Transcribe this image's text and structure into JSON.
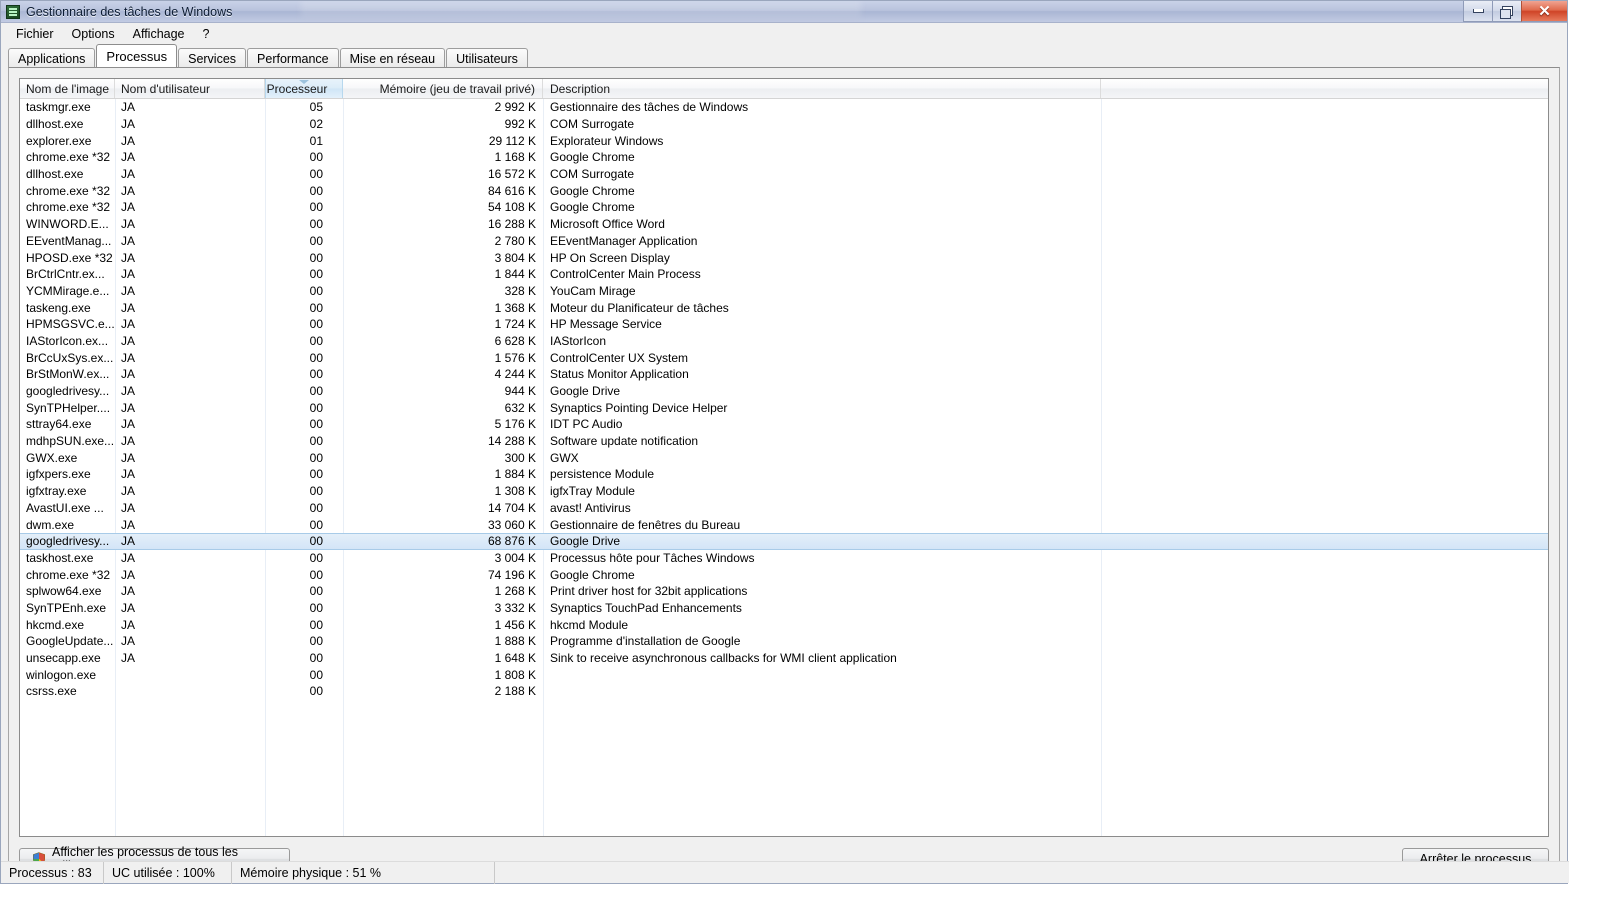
{
  "window": {
    "title": "Gestionnaire des tâches de Windows",
    "icon": "taskmanager-icon",
    "minimize_label": "",
    "maximize_label": "",
    "close_label": "✕"
  },
  "menu": {
    "items": [
      "Fichier",
      "Options",
      "Affichage",
      "?"
    ]
  },
  "tabs": {
    "items": [
      {
        "label": "Applications",
        "active": false
      },
      {
        "label": "Processus",
        "active": true
      },
      {
        "label": "Services",
        "active": false
      },
      {
        "label": "Performance",
        "active": false
      },
      {
        "label": "Mise en réseau",
        "active": false
      },
      {
        "label": "Utilisateurs",
        "active": false
      }
    ]
  },
  "table": {
    "columns": [
      {
        "key": "name",
        "label": "Nom de l'image",
        "align": "left",
        "sorted": false
      },
      {
        "key": "user",
        "label": "Nom d'utilisateur",
        "align": "left",
        "sorted": false
      },
      {
        "key": "cpu",
        "label": "Processeur",
        "align": "center",
        "sorted": true,
        "sort_dir": "desc"
      },
      {
        "key": "mem",
        "label": "Mémoire (jeu de travail privé)",
        "align": "right",
        "sorted": false
      },
      {
        "key": "desc",
        "label": "Description",
        "align": "left",
        "sorted": false
      }
    ],
    "selected_index": 26,
    "rows": [
      {
        "name": "taskmgr.exe",
        "user": "JA",
        "cpu": "05",
        "mem": "2 992 K",
        "desc": "Gestionnaire des tâches de Windows"
      },
      {
        "name": "dllhost.exe",
        "user": "JA",
        "cpu": "02",
        "mem": "992 K",
        "desc": "COM Surrogate"
      },
      {
        "name": "explorer.exe",
        "user": "JA",
        "cpu": "01",
        "mem": "29 112 K",
        "desc": "Explorateur Windows"
      },
      {
        "name": "chrome.exe *32",
        "user": "JA",
        "cpu": "00",
        "mem": "1 168 K",
        "desc": "Google Chrome"
      },
      {
        "name": "dllhost.exe",
        "user": "JA",
        "cpu": "00",
        "mem": "16 572 K",
        "desc": "COM Surrogate"
      },
      {
        "name": "chrome.exe *32",
        "user": "JA",
        "cpu": "00",
        "mem": "84 616 K",
        "desc": "Google Chrome"
      },
      {
        "name": "chrome.exe *32",
        "user": "JA",
        "cpu": "00",
        "mem": "54 108 K",
        "desc": "Google Chrome"
      },
      {
        "name": "WINWORD.E...",
        "user": "JA",
        "cpu": "00",
        "mem": "16 288 K",
        "desc": "Microsoft Office Word"
      },
      {
        "name": "EEventManag...",
        "user": "JA",
        "cpu": "00",
        "mem": "2 780 K",
        "desc": "EEventManager Application"
      },
      {
        "name": "HPOSD.exe *32",
        "user": "JA",
        "cpu": "00",
        "mem": "3 804 K",
        "desc": "HP On Screen Display"
      },
      {
        "name": "BrCtrlCntr.ex...",
        "user": "JA",
        "cpu": "00",
        "mem": "1 844 K",
        "desc": "ControlCenter Main Process"
      },
      {
        "name": "YCMMirage.e...",
        "user": "JA",
        "cpu": "00",
        "mem": "328 K",
        "desc": "YouCam Mirage"
      },
      {
        "name": "taskeng.exe",
        "user": "JA",
        "cpu": "00",
        "mem": "1 368 K",
        "desc": "Moteur du Planificateur de tâches"
      },
      {
        "name": "HPMSGSVC.e...",
        "user": "JA",
        "cpu": "00",
        "mem": "1 724 K",
        "desc": "HP Message Service"
      },
      {
        "name": "IAStorIcon.ex...",
        "user": "JA",
        "cpu": "00",
        "mem": "6 628 K",
        "desc": "IAStorIcon"
      },
      {
        "name": "BrCcUxSys.ex...",
        "user": "JA",
        "cpu": "00",
        "mem": "1 576 K",
        "desc": "ControlCenter UX System"
      },
      {
        "name": "BrStMonW.ex...",
        "user": "JA",
        "cpu": "00",
        "mem": "4 244 K",
        "desc": "Status Monitor Application"
      },
      {
        "name": "googledrivesy...",
        "user": "JA",
        "cpu": "00",
        "mem": "944 K",
        "desc": "Google Drive"
      },
      {
        "name": "SynTPHelper....",
        "user": "JA",
        "cpu": "00",
        "mem": "632 K",
        "desc": "Synaptics Pointing Device Helper"
      },
      {
        "name": "sttray64.exe",
        "user": "JA",
        "cpu": "00",
        "mem": "5 176 K",
        "desc": "IDT PC Audio"
      },
      {
        "name": "mdhpSUN.exe...",
        "user": "JA",
        "cpu": "00",
        "mem": "14 288 K",
        "desc": "Software update notification"
      },
      {
        "name": "GWX.exe",
        "user": "JA",
        "cpu": "00",
        "mem": "300 K",
        "desc": "GWX"
      },
      {
        "name": "igfxpers.exe",
        "user": "JA",
        "cpu": "00",
        "mem": "1 884 K",
        "desc": "persistence Module"
      },
      {
        "name": "igfxtray.exe",
        "user": "JA",
        "cpu": "00",
        "mem": "1 308 K",
        "desc": "igfxTray Module"
      },
      {
        "name": "AvastUI.exe ...",
        "user": "JA",
        "cpu": "00",
        "mem": "14 704 K",
        "desc": "avast! Antivirus"
      },
      {
        "name": "dwm.exe",
        "user": "JA",
        "cpu": "00",
        "mem": "33 060 K",
        "desc": "Gestionnaire de fenêtres du Bureau"
      },
      {
        "name": "googledrivesy...",
        "user": "JA",
        "cpu": "00",
        "mem": "68 876 K",
        "desc": "Google Drive"
      },
      {
        "name": "taskhost.exe",
        "user": "JA",
        "cpu": "00",
        "mem": "3 004 K",
        "desc": "Processus hôte pour Tâches Windows"
      },
      {
        "name": "chrome.exe *32",
        "user": "JA",
        "cpu": "00",
        "mem": "74 196 K",
        "desc": "Google Chrome"
      },
      {
        "name": "splwow64.exe",
        "user": "JA",
        "cpu": "00",
        "mem": "1 268 K",
        "desc": "Print driver host for 32bit applications"
      },
      {
        "name": "SynTPEnh.exe",
        "user": "JA",
        "cpu": "00",
        "mem": "3 332 K",
        "desc": "Synaptics TouchPad Enhancements"
      },
      {
        "name": "hkcmd.exe",
        "user": "JA",
        "cpu": "00",
        "mem": "1 456 K",
        "desc": "hkcmd Module"
      },
      {
        "name": "GoogleUpdate...",
        "user": "JA",
        "cpu": "00",
        "mem": "1 888 K",
        "desc": "Programme d'installation de Google"
      },
      {
        "name": "unsecapp.exe",
        "user": "JA",
        "cpu": "00",
        "mem": "1 648 K",
        "desc": "Sink to receive asynchronous callbacks for WMI client application"
      },
      {
        "name": "winlogon.exe",
        "user": "",
        "cpu": "00",
        "mem": "1 808 K",
        "desc": ""
      },
      {
        "name": "csrss.exe",
        "user": "",
        "cpu": "00",
        "mem": "2 188 K",
        "desc": ""
      }
    ]
  },
  "buttons": {
    "show_all_users": "Afficher les processus de tous les utilisateurs",
    "end_process": "Arrêter le processus"
  },
  "statusbar": {
    "processes": "Processus : 83",
    "cpu_usage": "UC utilisée : 100%",
    "physical_memory": "Mémoire physique : 51 %"
  },
  "colors": {
    "selection": "#d3e5f7",
    "selection_border": "#a8cbe8",
    "sorted_header": "#cfe5f6",
    "close_button": "#cf4427"
  }
}
